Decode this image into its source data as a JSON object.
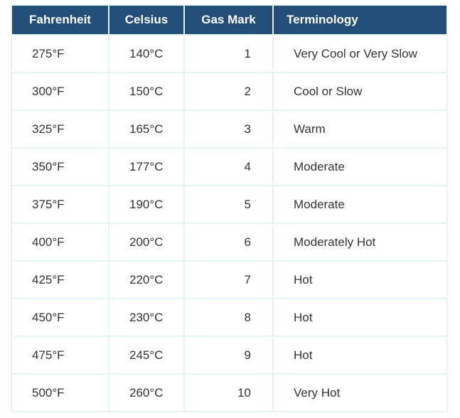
{
  "table": {
    "headers": [
      "Fahrenheit",
      "Celsius",
      "Gas Mark",
      "Terminology"
    ],
    "rows": [
      [
        "275°F",
        "140°C",
        "1",
        "Very Cool or Very Slow"
      ],
      [
        "300°F",
        "150°C",
        "2",
        "Cool or Slow"
      ],
      [
        "325°F",
        "165°C",
        "3",
        "Warm"
      ],
      [
        "350°F",
        "177°C",
        "4",
        "Moderate"
      ],
      [
        "375°F",
        "190°C",
        "5",
        "Moderate"
      ],
      [
        "400°F",
        "200°C",
        "6",
        "Moderately Hot"
      ],
      [
        "425°F",
        "220°C",
        "7",
        "Hot"
      ],
      [
        "450°F",
        "230°C",
        "8",
        "Hot"
      ],
      [
        "475°F",
        "245°C",
        "9",
        "Hot"
      ],
      [
        "500°F",
        "260°C",
        "10",
        "Very Hot"
      ]
    ]
  },
  "colors": {
    "header_bg": "#234e78",
    "header_text": "#ffffff",
    "border": "#e3f3f6",
    "cell_text": "#333333"
  }
}
